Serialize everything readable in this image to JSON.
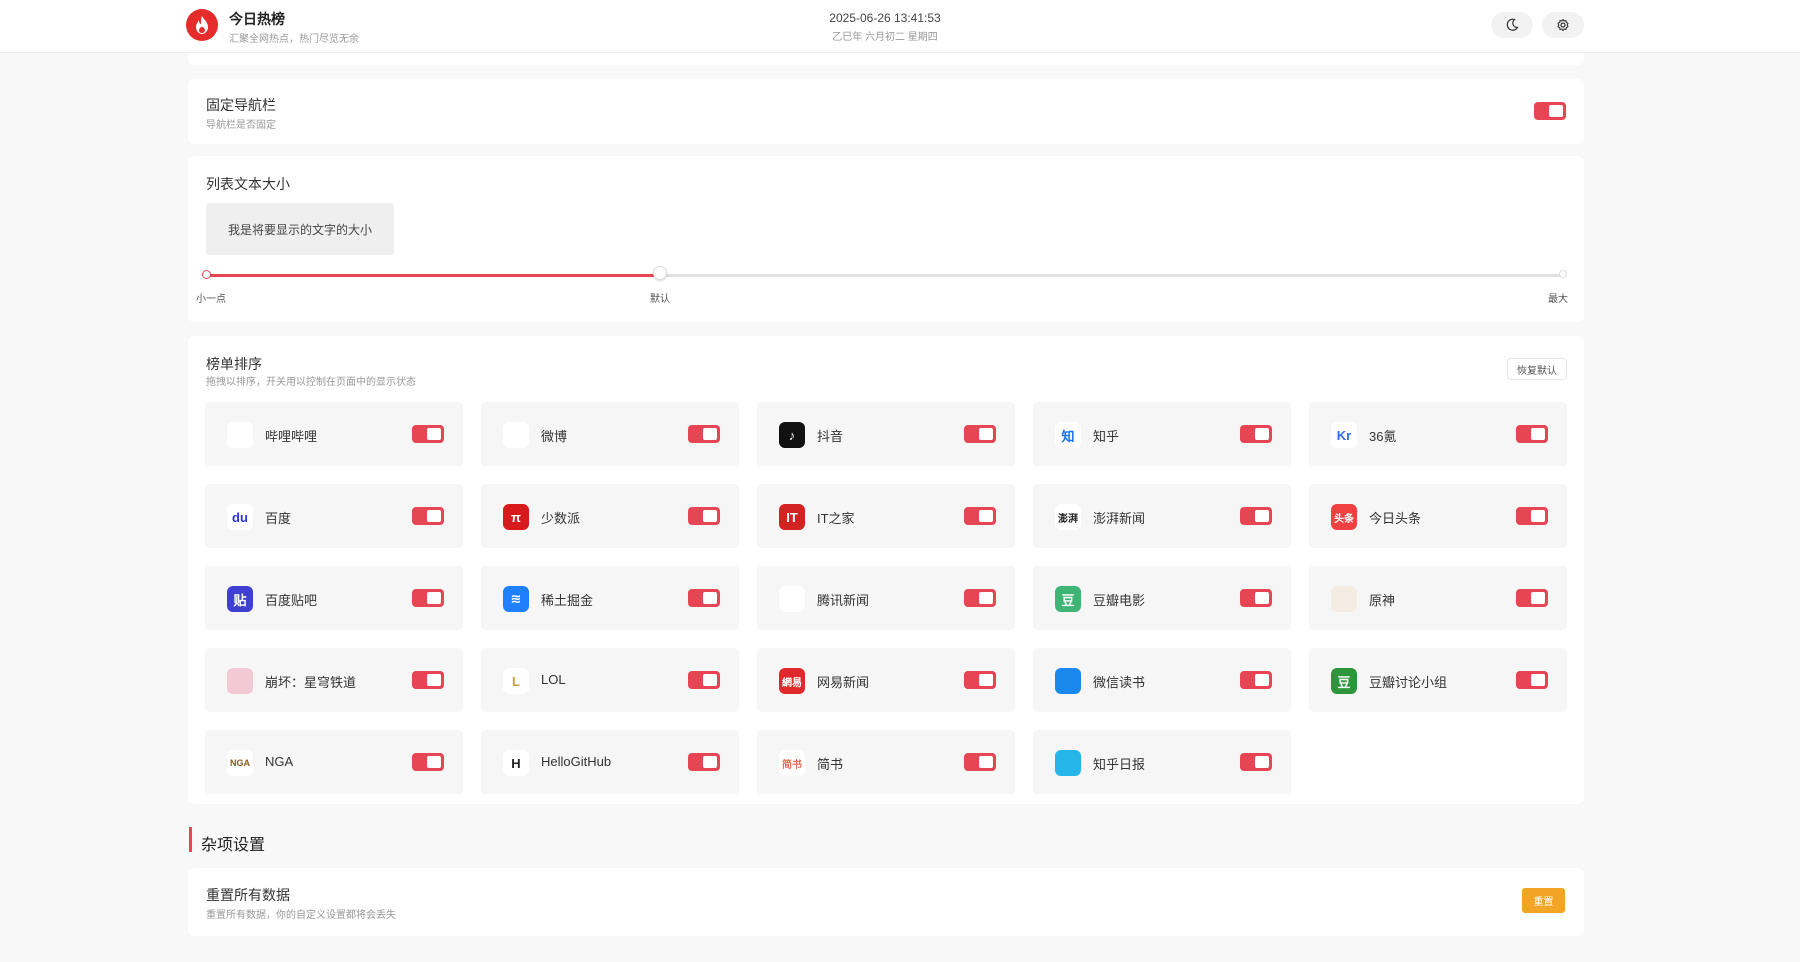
{
  "header": {
    "title": "今日热榜",
    "subtitle": "汇聚全网热点，热门尽览无余",
    "datetime": "2025-06-26 13:41:53",
    "lunar": "乙巳年 六月初二 星期四",
    "theme_icon": "moon-icon",
    "settings_icon": "gear-icon",
    "brand_color": "#e62b2b"
  },
  "fixed_nav": {
    "title": "固定导航栏",
    "desc": "导航栏是否固定",
    "enabled": true
  },
  "font_size": {
    "title": "列表文本大小",
    "preview_text": "我是将要显示的文字的大小",
    "labels": {
      "min": "小一点",
      "default": "默认",
      "max": "最大"
    },
    "value_fraction": 0.333
  },
  "sort": {
    "title": "榜单排序",
    "desc": "拖拽以排序，开关用以控制在页面中的显示状态",
    "restore_label": "恢复默认",
    "items": [
      {
        "name": "哔哩哔哩",
        "icon": "bilibili-icon",
        "glyph": "",
        "color": "#fff",
        "enabled": true
      },
      {
        "name": "微博",
        "icon": "weibo-icon",
        "glyph": "",
        "color": "#fff",
        "enabled": true
      },
      {
        "name": "抖音",
        "icon": "douyin-icon",
        "glyph": "♪",
        "color": "#111",
        "enabled": true
      },
      {
        "name": "知乎",
        "icon": "zhihu-icon",
        "glyph": "知",
        "color": "#fff",
        "enabled": true
      },
      {
        "name": "36氪",
        "icon": "36kr-icon",
        "glyph": "Kr",
        "color": "#fff",
        "enabled": true
      },
      {
        "name": "百度",
        "icon": "baidu-icon",
        "glyph": "du",
        "color": "#fff",
        "enabled": true
      },
      {
        "name": "少数派",
        "icon": "sspai-icon",
        "glyph": "π",
        "color": "#d71a1b",
        "enabled": true
      },
      {
        "name": "IT之家",
        "icon": "ithome-icon",
        "glyph": "IT",
        "color": "#d22222",
        "enabled": true
      },
      {
        "name": "澎湃新闻",
        "icon": "thepaper-icon",
        "glyph": "澎湃",
        "color": "#fff",
        "enabled": true
      },
      {
        "name": "今日头条",
        "icon": "toutiao-icon",
        "glyph": "头条",
        "color": "#f04142",
        "enabled": true
      },
      {
        "name": "百度贴吧",
        "icon": "tieba-icon",
        "glyph": "贴",
        "color": "#3f3fd1",
        "enabled": true
      },
      {
        "name": "稀土掘金",
        "icon": "juejin-icon",
        "glyph": "≋",
        "color": "#1e80ff",
        "enabled": true
      },
      {
        "name": "腾讯新闻",
        "icon": "qq-news-icon",
        "glyph": "",
        "color": "#fff",
        "enabled": true
      },
      {
        "name": "豆瓣电影",
        "icon": "douban-movie-icon",
        "glyph": "豆",
        "color": "#3eb575",
        "enabled": true
      },
      {
        "name": "原神",
        "icon": "genshin-icon",
        "glyph": "",
        "color": "#f3ece3",
        "enabled": true
      },
      {
        "name": "崩坏：星穹铁道",
        "icon": "starrail-icon",
        "glyph": "",
        "color": "#f4c9d6",
        "enabled": true
      },
      {
        "name": "LOL",
        "icon": "lol-icon",
        "glyph": "L",
        "color": "#fff",
        "enabled": true
      },
      {
        "name": "网易新闻",
        "icon": "netease-news-icon",
        "glyph": "網易",
        "color": "#e0292a",
        "enabled": true
      },
      {
        "name": "微信读书",
        "icon": "weread-icon",
        "glyph": "",
        "color": "#1b88ee",
        "enabled": true
      },
      {
        "name": "豆瓣讨论小组",
        "icon": "douban-group-icon",
        "glyph": "豆",
        "color": "#2d963d",
        "enabled": true
      },
      {
        "name": "NGA",
        "icon": "nga-icon",
        "glyph": "NGA",
        "color": "#fff",
        "enabled": true
      },
      {
        "name": "HelloGitHub",
        "icon": "hellogithub-icon",
        "glyph": "H",
        "color": "#fff",
        "enabled": true
      },
      {
        "name": "简书",
        "icon": "jianshu-icon",
        "glyph": "简书",
        "color": "#fff",
        "enabled": true
      },
      {
        "name": "知乎日报",
        "icon": "zhihu-daily-icon",
        "glyph": "",
        "color": "#25b5e8",
        "enabled": true
      }
    ]
  },
  "misc": {
    "title": "杂项设置",
    "reset": {
      "title": "重置所有数据",
      "desc": "重置所有数据，你的自定义设置都将会丢失",
      "button": "重置"
    }
  },
  "colors": {
    "accent": "#e64553",
    "warning": "#f2a424"
  }
}
